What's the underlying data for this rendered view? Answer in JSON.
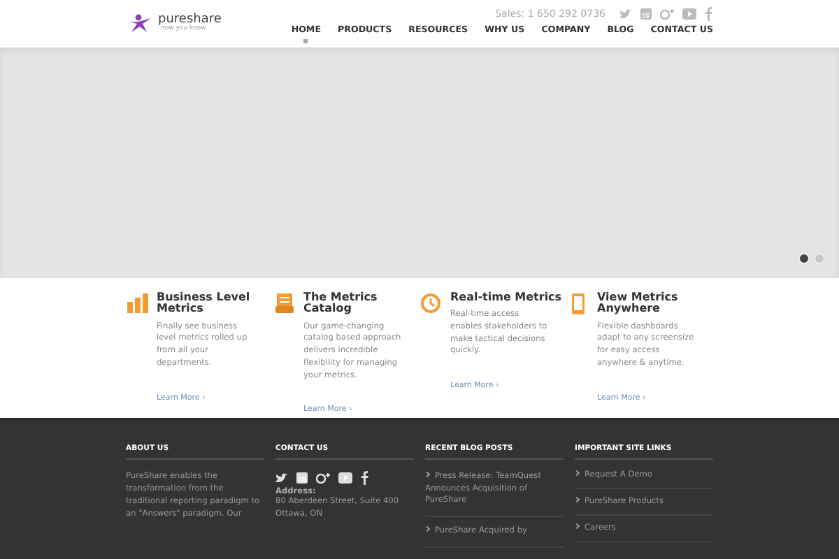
{
  "header": {
    "logo": {
      "name": "pureshare",
      "tagline": "now you know"
    },
    "sales": "Sales: 1 650 292 0736",
    "nav": [
      {
        "label": "HOME",
        "selected": true
      },
      {
        "label": "PRODUCTS",
        "selected": false
      },
      {
        "label": "RESOURCES",
        "selected": false
      },
      {
        "label": "WHY US",
        "selected": false
      },
      {
        "label": "COMPANY",
        "selected": false
      },
      {
        "label": "BLOG",
        "selected": false
      },
      {
        "label": "CONTACT US",
        "selected": false
      }
    ]
  },
  "slider": {
    "dots": [
      {
        "selected": true
      },
      {
        "selected": false
      }
    ]
  },
  "features": [
    {
      "kind": "bars",
      "title": "Business Level Metrics",
      "text": "Finally see business level metrics rolled up from all your departments.",
      "link": "Learn More ›"
    },
    {
      "kind": "catalog",
      "title": "The Metrics Catalog",
      "text": "Our game-changing catalog based approach delivers incredible flexibility for managing your metrics.",
      "link": "Learn More ›"
    },
    {
      "kind": "clock",
      "title": "Real-time Metrics",
      "text": "Real-time access enables stakeholders to make tactical decisions quickly.",
      "link": "Learn More ›"
    },
    {
      "kind": "phone",
      "title": "View Metrics Anywhere",
      "text": "Flexible dashboards adapt to any screensize for easy access anywhere & anytime.",
      "link": "Learn More ›"
    }
  ],
  "footer": {
    "about": {
      "heading": "ABOUT US",
      "text": "PureShare enables the transformation from the traditional reporting paradigm to an \"Answers\" paradigm. Our"
    },
    "contact": {
      "heading": "CONTACT US",
      "address_label": "Address:",
      "address": [
        "80 Aberdeen Street, Suite 400",
        "Ottawa, ON"
      ]
    },
    "blog": {
      "heading": "RECENT BLOG POSTS",
      "posts": [
        "Press Release: TeamQuest Announces Acquisition of PureShare",
        "PureShare Acquired by"
      ]
    },
    "links": {
      "heading": "IMPORTANT SITE LINKS",
      "items": [
        "Request A Demo",
        "PureShare Products",
        "Careers"
      ]
    }
  }
}
